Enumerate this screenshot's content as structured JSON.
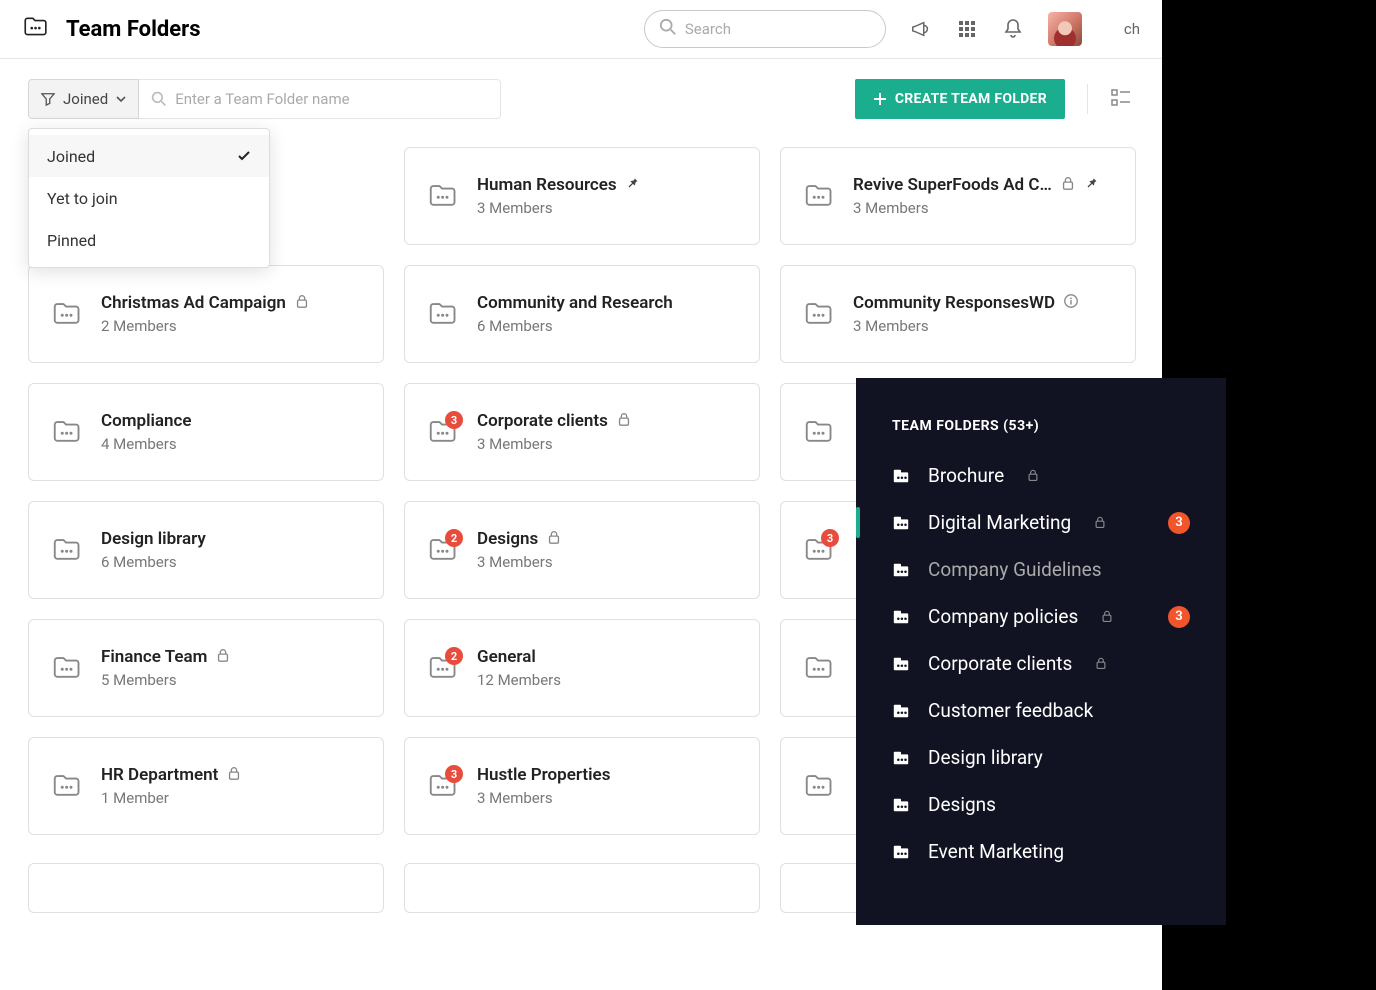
{
  "header": {
    "title": "Team Folders",
    "search_placeholder": "Search",
    "edge_text": "ch"
  },
  "toolbar": {
    "filter_label": "Joined",
    "name_search_placeholder": "Enter a Team Folder name",
    "create_label": "CREATE TEAM FOLDER"
  },
  "dropdown": {
    "items": [
      {
        "label": "Joined",
        "selected": true
      },
      {
        "label": "Yet to join",
        "selected": false
      },
      {
        "label": "Pinned",
        "selected": false
      }
    ]
  },
  "folders": [
    {
      "title": "",
      "members": "",
      "lock": false,
      "pin": false,
      "info": false,
      "badge": null,
      "hidden_under_dropdown": true
    },
    {
      "title": "Human Resources",
      "members": "3 Members",
      "lock": false,
      "pin": true,
      "info": false,
      "badge": null
    },
    {
      "title": "Revive SuperFoods Ad C…",
      "members": "3 Members",
      "lock": true,
      "pin": true,
      "info": false,
      "badge": null
    },
    {
      "title": "Christmas Ad Campaign",
      "members": "2 Members",
      "lock": true,
      "pin": false,
      "info": false,
      "badge": null
    },
    {
      "title": "Community and Research",
      "members": "6 Members",
      "lock": false,
      "pin": false,
      "info": false,
      "badge": null
    },
    {
      "title": "Community ResponsesWD",
      "members": "3 Members",
      "lock": false,
      "pin": false,
      "info": true,
      "badge": null
    },
    {
      "title": "Compliance",
      "members": "4 Members",
      "lock": false,
      "pin": false,
      "info": false,
      "badge": null
    },
    {
      "title": "Corporate clients",
      "members": "3 Members",
      "lock": true,
      "pin": false,
      "info": false,
      "badge": "3"
    },
    {
      "title": "",
      "members": "",
      "lock": false,
      "pin": false,
      "info": false,
      "badge": null,
      "icon_only": true
    },
    {
      "title": "Design library",
      "members": "6 Members",
      "lock": false,
      "pin": false,
      "info": false,
      "badge": null
    },
    {
      "title": "Designs",
      "members": "3 Members",
      "lock": true,
      "pin": false,
      "info": false,
      "badge": "2"
    },
    {
      "title": "",
      "members": "",
      "lock": false,
      "pin": false,
      "info": false,
      "badge": "3",
      "icon_only": true
    },
    {
      "title": "Finance Team",
      "members": "5 Members",
      "lock": true,
      "pin": false,
      "info": false,
      "badge": null
    },
    {
      "title": "General",
      "members": "12 Members",
      "lock": false,
      "pin": false,
      "info": false,
      "badge": "2"
    },
    {
      "title": "",
      "members": "",
      "lock": false,
      "pin": false,
      "info": false,
      "badge": null,
      "icon_only": true
    },
    {
      "title": "HR Department",
      "members": "1 Member",
      "lock": true,
      "pin": false,
      "info": false,
      "badge": null
    },
    {
      "title": "Hustle Properties",
      "members": "3 Members",
      "lock": false,
      "pin": false,
      "info": false,
      "badge": "3"
    },
    {
      "title": "",
      "members": "",
      "lock": false,
      "pin": false,
      "info": false,
      "badge": null,
      "icon_only": true
    }
  ],
  "side_panel": {
    "heading": "TEAM FOLDERS (53+)",
    "items": [
      {
        "label": "Brochure",
        "lock": true,
        "badge": null,
        "active": false,
        "dim": false
      },
      {
        "label": "Digital Marketing",
        "lock": true,
        "badge": "3",
        "active": true,
        "dim": false
      },
      {
        "label": "Company Guidelines",
        "lock": false,
        "badge": null,
        "active": false,
        "dim": true
      },
      {
        "label": "Company policies",
        "lock": true,
        "badge": "3",
        "active": false,
        "dim": false
      },
      {
        "label": "Corporate clients",
        "lock": true,
        "badge": null,
        "active": false,
        "dim": false
      },
      {
        "label": "Customer feedback",
        "lock": false,
        "badge": null,
        "active": false,
        "dim": false
      },
      {
        "label": "Design library",
        "lock": false,
        "badge": null,
        "active": false,
        "dim": false
      },
      {
        "label": "Designs",
        "lock": false,
        "badge": null,
        "active": false,
        "dim": false
      },
      {
        "label": "Event Marketing",
        "lock": false,
        "badge": null,
        "active": false,
        "dim": false
      }
    ]
  }
}
